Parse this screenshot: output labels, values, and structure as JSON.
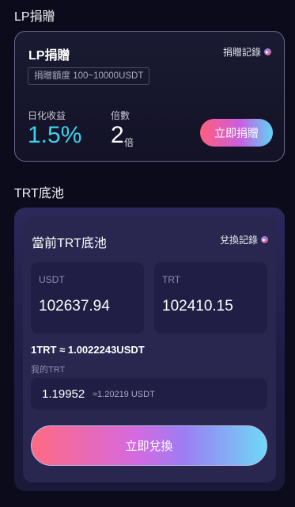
{
  "lp": {
    "section_title": "LP捐贈",
    "card_title": "LP捐贈",
    "record_label": "捐贈記錄",
    "range_label": "捐贈額度 100~10000USDT",
    "daily_yield_label": "日化收益",
    "daily_yield_value": "1.5%",
    "multiplier_label": "倍數",
    "multiplier_value": "2",
    "multiplier_unit": "倍",
    "donate_button": "立即捐贈"
  },
  "trt": {
    "section_title": "TRT底池",
    "pool_title": "當前TRT底池",
    "record_label": "兌換記錄",
    "usdt_label": "USDT",
    "usdt_value": "102637.94",
    "trt_label": "TRT",
    "trt_value": "102410.15",
    "rate_text": "1TRT ≈ 1.0022243USDT",
    "my_trt_label": "我的TRT",
    "my_trt_value": "1.19952",
    "my_trt_approx": "≈1.20219 USDT",
    "swap_button": "立即兌換"
  },
  "colors": {
    "accent_cyan": "#3bd2ee",
    "gradient_start": "#ff5e7e",
    "gradient_end": "#5fd4f5",
    "background": "#0c0b1c"
  }
}
